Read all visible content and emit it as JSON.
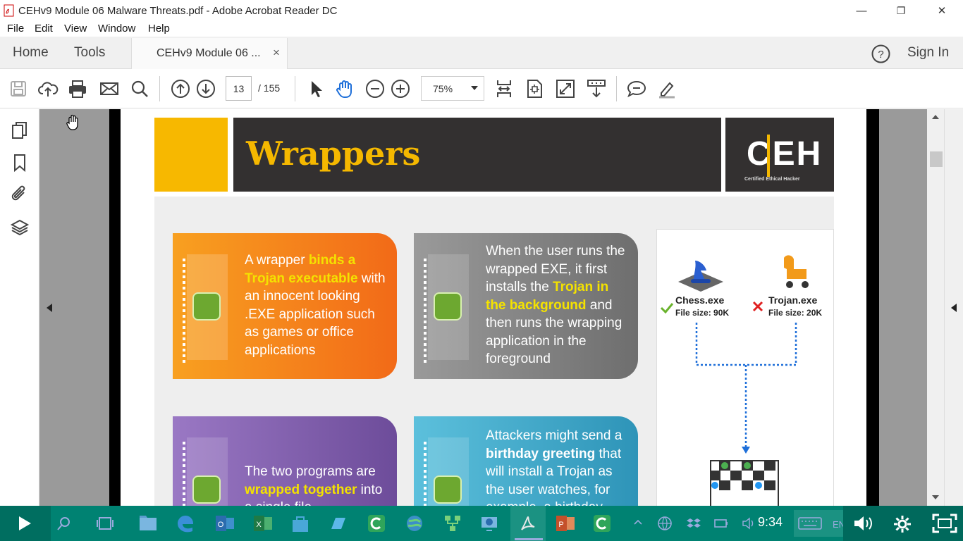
{
  "window": {
    "title": "CEHv9 Module 06 Malware Threats.pdf - Adobe Acrobat Reader DC",
    "minimize": "—",
    "restore": "❐",
    "close": "✕"
  },
  "menu": [
    "File",
    "Edit",
    "View",
    "Window",
    "Help"
  ],
  "tabs": {
    "home": "Home",
    "tools": "Tools",
    "document": "CEHv9 Module 06 ...",
    "document_close": "×",
    "help_icon": "help-icon",
    "sign_in": "Sign In"
  },
  "toolbar": {
    "current_page": "13",
    "total_pages": "/  155",
    "zoom": "75%"
  },
  "pdf": {
    "heading": "Wrappers",
    "logo_text": "CEH",
    "logo_sub": "Certified  Ethical  Hacker",
    "card1": {
      "t1": "A wrapper ",
      "h1": "binds a",
      "h2": "Trojan executable",
      "t2": " with",
      "t3": "an innocent looking",
      "t4": ".EXE application such",
      "t5": "as games or office",
      "t6": "applications"
    },
    "card2": {
      "t1": "When the user runs the",
      "t2": "wrapped EXE, it first",
      "t3": "installs the ",
      "h1": "Trojan in",
      "h2": "the background",
      "t4": " and",
      "t5": "then runs the wrapping",
      "t6": "application in the",
      "t7": "foreground"
    },
    "card3": {
      "t1": "The two programs are",
      "h1": "wrapped together",
      "t2": " into",
      "t3": "a single file"
    },
    "card4": {
      "t1": "Attackers might send a",
      "h1": "birthday greeting",
      "t2": " that",
      "t3": "will install a Trojan as",
      "t4": "the user watches, for",
      "t5": "example, a birthday"
    },
    "chess_name": "Chess.exe",
    "chess_size": "File size: 90K",
    "trojan_name": "Trojan.exe",
    "trojan_size": "File size: 20K"
  },
  "taskbar": {
    "time": "9:34",
    "lang": "EN"
  },
  "colors": {
    "taskbar": "#008272",
    "orange": "#f47a1f",
    "gray_card": "#7c7c7c",
    "purple": "#7a5aa6",
    "teal": "#3aa3c4",
    "yellow": "#f7b800"
  }
}
